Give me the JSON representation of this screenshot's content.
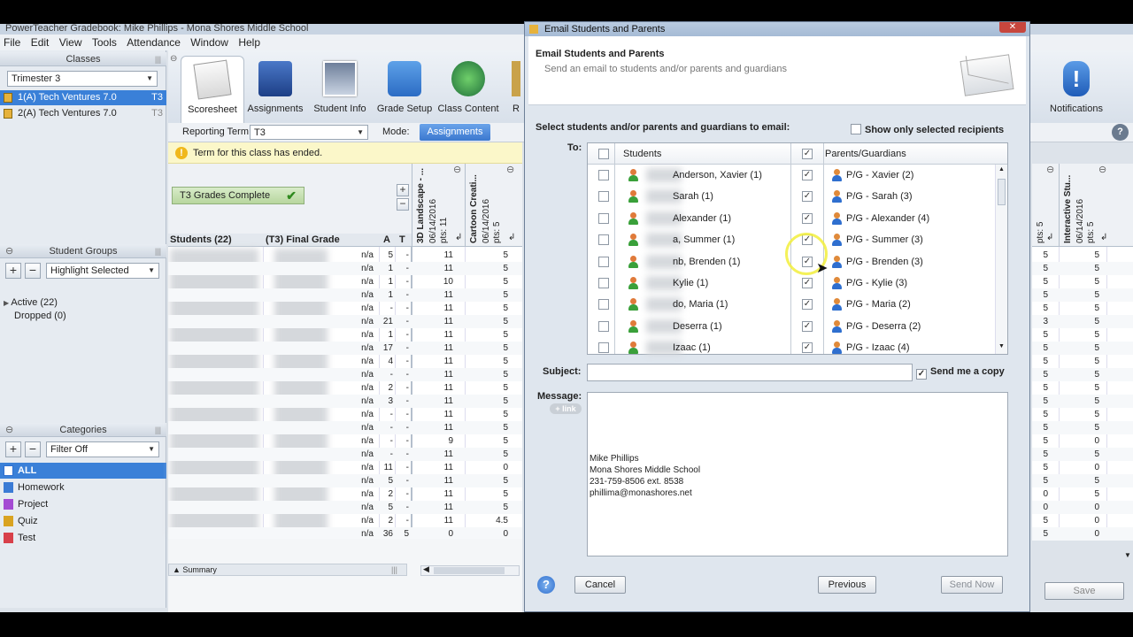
{
  "app": {
    "title": "PowerTeacher Gradebook: Mike Phillips - Mona Shores Middle School",
    "menu": [
      "File",
      "Edit",
      "View",
      "Tools",
      "Attendance",
      "Window",
      "Help"
    ]
  },
  "classes": {
    "header": "Classes",
    "term": "Trimester 3",
    "items": [
      {
        "label": "1(A) Tech Ventures 7.0",
        "term": "T3"
      },
      {
        "label": "2(A) Tech Ventures 7.0",
        "term": "T3"
      }
    ]
  },
  "toolbar": {
    "items": [
      "Scoresheet",
      "Assignments",
      "Student Info",
      "Grade Setup",
      "Class Content",
      "R"
    ],
    "notifications": "Notifications"
  },
  "reporting": {
    "label": "Reporting Term:",
    "value": "T3",
    "mode_label": "Mode:",
    "mode_value": "Assignments"
  },
  "notice": "Term for this class has ended.",
  "grades_complete": "T3 Grades Complete",
  "student_groups": {
    "header": "Student Groups",
    "filter": "Highlight Selected",
    "active": "Active (22)",
    "dropped": "Dropped (0)"
  },
  "categories": {
    "header": "Categories",
    "filter": "Filter Off",
    "items": [
      "ALL",
      "Homework",
      "Project",
      "Quiz",
      "Test"
    ],
    "colors": [
      "#2f6fd0",
      "#3a7bd5",
      "#a44bd3",
      "#d9a321",
      "#d8404a"
    ]
  },
  "grid": {
    "col_students": "Students (22)",
    "col_final": "(T3) Final Grade",
    "col_a": "A",
    "col_t": "T",
    "assign1": {
      "name": "3D Landscape - ...",
      "date": "06/14/2016",
      "pts": "pts: 11"
    },
    "assign2": {
      "name": "Cartoon Creati...",
      "date": "06/14/2016",
      "pts": "pts: 5"
    },
    "summary": "Summary",
    "rows": [
      [
        "n/a",
        "5",
        "-",
        "11",
        "5"
      ],
      [
        "n/a",
        "1",
        "-",
        "11",
        "5"
      ],
      [
        "n/a",
        "1",
        "-",
        "10",
        "5"
      ],
      [
        "n/a",
        "1",
        "-",
        "11",
        "5"
      ],
      [
        "n/a",
        "-",
        "-",
        "11",
        "5"
      ],
      [
        "n/a",
        "21",
        "-",
        "11",
        "5"
      ],
      [
        "n/a",
        "1",
        "-",
        "11",
        "5"
      ],
      [
        "n/a",
        "17",
        "-",
        "11",
        "5"
      ],
      [
        "n/a",
        "4",
        "-",
        "11",
        "5"
      ],
      [
        "n/a",
        "-",
        "-",
        "11",
        "5"
      ],
      [
        "n/a",
        "2",
        "-",
        "11",
        "5"
      ],
      [
        "n/a",
        "3",
        "-",
        "11",
        "5"
      ],
      [
        "n/a",
        "-",
        "-",
        "11",
        "5"
      ],
      [
        "n/a",
        "-",
        "-",
        "11",
        "5"
      ],
      [
        "n/a",
        "-",
        "-",
        "9",
        "5"
      ],
      [
        "n/a",
        "-",
        "-",
        "11",
        "5"
      ],
      [
        "n/a",
        "11",
        "-",
        "11",
        "0"
      ],
      [
        "n/a",
        "5",
        "-",
        "11",
        "5"
      ],
      [
        "n/a",
        "2",
        "-",
        "11",
        "5"
      ],
      [
        "n/a",
        "5",
        "-",
        "11",
        "5"
      ],
      [
        "n/a",
        "2",
        "-",
        "11",
        "4.5"
      ],
      [
        "n/a",
        "36",
        "5",
        "0",
        "0"
      ]
    ]
  },
  "right_grid": {
    "col1": "pts: 5",
    "col2_name": "Interactive Stu...",
    "col2_date": "06/14/2016",
    "col2_pts": "pts: 5",
    "save": "Save",
    "rows": [
      [
        "5",
        "5"
      ],
      [
        "5",
        "5"
      ],
      [
        "5",
        "5"
      ],
      [
        "5",
        "5"
      ],
      [
        "5",
        "5"
      ],
      [
        "3",
        "5"
      ],
      [
        "5",
        "5"
      ],
      [
        "5",
        "5"
      ],
      [
        "5",
        "5"
      ],
      [
        "5",
        "5"
      ],
      [
        "5",
        "5"
      ],
      [
        "5",
        "5"
      ],
      [
        "5",
        "5"
      ],
      [
        "5",
        "5"
      ],
      [
        "5",
        "0"
      ],
      [
        "5",
        "5"
      ],
      [
        "5",
        "0"
      ],
      [
        "5",
        "5"
      ],
      [
        "0",
        "5"
      ],
      [
        "0",
        "0"
      ],
      [
        "5",
        "0"
      ],
      [
        "5",
        "0"
      ]
    ]
  },
  "dialog": {
    "title": "Email Students and Parents",
    "heading": "Email Students and Parents",
    "subheading": "Send an email to students and/or parents and guardians",
    "select_label": "Select students and/or parents and guardians to email:",
    "show_only": "Show only selected recipients",
    "to_label": "To:",
    "col_students": "Students",
    "col_parents": "Parents/Guardians",
    "rows": [
      {
        "student": "Anderson, Xavier (1)",
        "parent": "P/G - Xavier (2)"
      },
      {
        "student": "Sarah (1)",
        "parent": "P/G - Sarah (3)"
      },
      {
        "student": "Alexander (1)",
        "parent": "P/G - Alexander (4)"
      },
      {
        "student": "a, Summer (1)",
        "parent": "P/G - Summer (3)"
      },
      {
        "student": "nb, Brenden (1)",
        "parent": "P/G - Brenden (3)"
      },
      {
        "student": "Kylie (1)",
        "parent": "P/G - Kylie (3)"
      },
      {
        "student": "do, Maria (1)",
        "parent": "P/G - Maria (2)"
      },
      {
        "student": "Deserra (1)",
        "parent": "P/G - Deserra (2)"
      },
      {
        "student": "Izaac (1)",
        "parent": "P/G - Izaac (4)"
      }
    ],
    "subject_label": "Subject:",
    "subject_value": "",
    "send_copy": "Send me a copy",
    "message_label": "Message:",
    "link_btn": "+ link",
    "signature": [
      "Mike Phillips",
      "Mona Shores Middle School",
      "231-759-8506 ext. 8538",
      "phillima@monashores.net"
    ],
    "cancel": "Cancel",
    "previous": "Previous",
    "send": "Send Now"
  }
}
